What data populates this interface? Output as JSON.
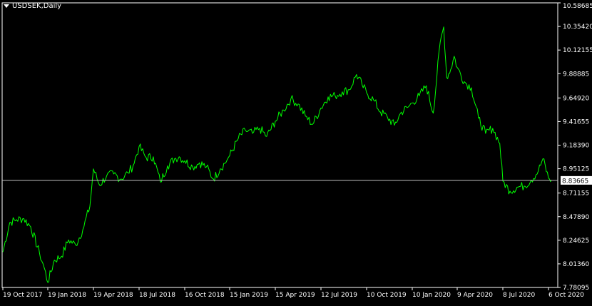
{
  "chart_data": {
    "type": "line",
    "symbol": "USDSEK,Daily",
    "title": "",
    "xlabel": "",
    "ylabel": "",
    "ylim": [
      7.78095,
      10.58685
    ],
    "y_ticks": [
      "10.58685",
      "10.35420",
      "10.12155",
      "9.88885",
      "9.64920",
      "9.41655",
      "9.18390",
      "8.95125",
      "8.71155",
      "8.47890",
      "8.24625",
      "8.01360",
      "7.78095"
    ],
    "x_ticks": [
      "19 Oct 2017",
      "19 Jan 2018",
      "19 Apr 2018",
      "18 Jul 2018",
      "16 Oct 2018",
      "15 Jan 2019",
      "15 Apr 2019",
      "12 Jul 2019",
      "10 Oct 2019",
      "10 Jan 2020",
      "9 Apr 2020",
      "8 Jul 2020",
      "6 Oct 2020"
    ],
    "current_price": "8.83665",
    "current_price_value": 8.83665,
    "grid": false,
    "legend": "none",
    "series": [
      {
        "color": "#00ff00",
        "x": [
          "2017-10-19",
          "2017-11-02",
          "2017-11-16",
          "2017-12-01",
          "2017-12-15",
          "2018-01-02",
          "2018-01-12",
          "2018-01-19",
          "2018-02-01",
          "2018-02-15",
          "2018-03-01",
          "2018-03-15",
          "2018-03-29",
          "2018-04-12",
          "2018-04-19",
          "2018-05-01",
          "2018-05-15",
          "2018-05-29",
          "2018-06-12",
          "2018-06-26",
          "2018-07-06",
          "2018-07-18",
          "2018-08-01",
          "2018-08-15",
          "2018-08-29",
          "2018-09-12",
          "2018-09-26",
          "2018-10-05",
          "2018-10-16",
          "2018-11-01",
          "2018-11-15",
          "2018-11-29",
          "2018-12-13",
          "2018-12-27",
          "2019-01-10",
          "2019-01-15",
          "2019-02-01",
          "2019-02-15",
          "2019-03-01",
          "2019-03-15",
          "2019-03-29",
          "2019-04-15",
          "2019-05-01",
          "2019-05-15",
          "2019-05-29",
          "2019-06-12",
          "2019-06-26",
          "2019-07-12",
          "2019-07-26",
          "2019-08-09",
          "2019-08-23",
          "2019-09-06",
          "2019-09-20",
          "2019-10-01",
          "2019-10-10",
          "2019-10-24",
          "2019-11-07",
          "2019-11-21",
          "2019-12-05",
          "2019-12-19",
          "2020-01-02",
          "2020-01-10",
          "2020-01-24",
          "2020-02-07",
          "2020-02-21",
          "2020-03-06",
          "2020-03-13",
          "2020-03-19",
          "2020-03-27",
          "2020-04-03",
          "2020-04-09",
          "2020-04-23",
          "2020-05-07",
          "2020-05-21",
          "2020-06-04",
          "2020-06-18",
          "2020-07-02",
          "2020-07-08",
          "2020-07-22",
          "2020-08-05",
          "2020-08-19",
          "2020-09-02",
          "2020-09-16",
          "2020-09-25",
          "2020-10-06",
          "2020-10-12"
        ],
        "values": [
          8.13,
          8.42,
          8.45,
          8.46,
          8.38,
          8.12,
          7.97,
          7.83,
          8.05,
          8.09,
          8.25,
          8.2,
          8.35,
          8.58,
          8.95,
          8.79,
          8.88,
          8.9,
          8.85,
          8.91,
          8.98,
          9.17,
          9.06,
          9.07,
          8.82,
          8.98,
          9.05,
          9.07,
          9.03,
          8.97,
          9.01,
          8.97,
          8.85,
          8.95,
          9.04,
          9.08,
          9.25,
          9.33,
          9.3,
          9.35,
          9.27,
          9.42,
          9.53,
          9.64,
          9.59,
          9.47,
          9.39,
          9.55,
          9.66,
          9.67,
          9.71,
          9.73,
          9.88,
          9.78,
          9.7,
          9.63,
          9.51,
          9.46,
          9.38,
          9.51,
          9.56,
          9.6,
          9.67,
          9.77,
          9.5,
          10.2,
          10.35,
          9.85,
          9.93,
          10.06,
          9.95,
          9.81,
          9.75,
          9.45,
          9.3,
          9.35,
          9.2,
          8.83,
          8.73,
          8.77,
          8.78,
          8.84,
          8.93,
          9.05,
          8.86,
          8.84
        ]
      }
    ]
  }
}
